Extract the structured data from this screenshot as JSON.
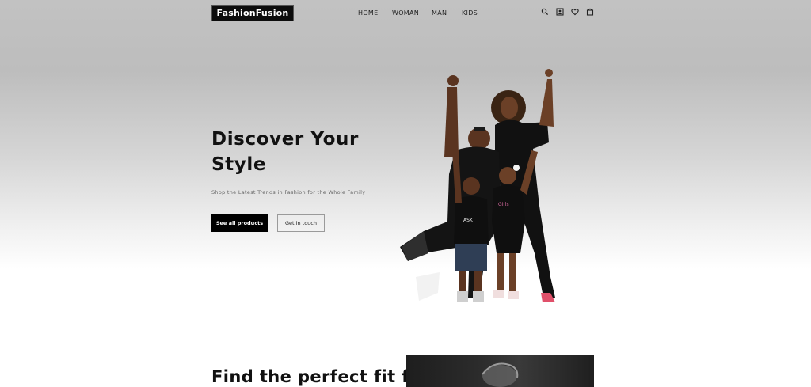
{
  "header": {
    "logo": "FashionFusion",
    "nav": [
      "HOME",
      "WOMAN",
      "MAN",
      "KIDS"
    ],
    "icons": [
      "search-icon",
      "account-icon",
      "heart-icon",
      "bag-icon"
    ]
  },
  "hero": {
    "title": "Discover Your Style",
    "subtitle": "Shop the Latest Trends in Fashion for the Whole Family",
    "primary_button": "See all products",
    "secondary_button": "Get in touch",
    "image": "family-photo"
  },
  "section2": {
    "title": "Find the perfect fit for"
  },
  "colors": {
    "accent": "#000000",
    "hero_top": "#bdbdbd",
    "background": "#ffffff"
  }
}
